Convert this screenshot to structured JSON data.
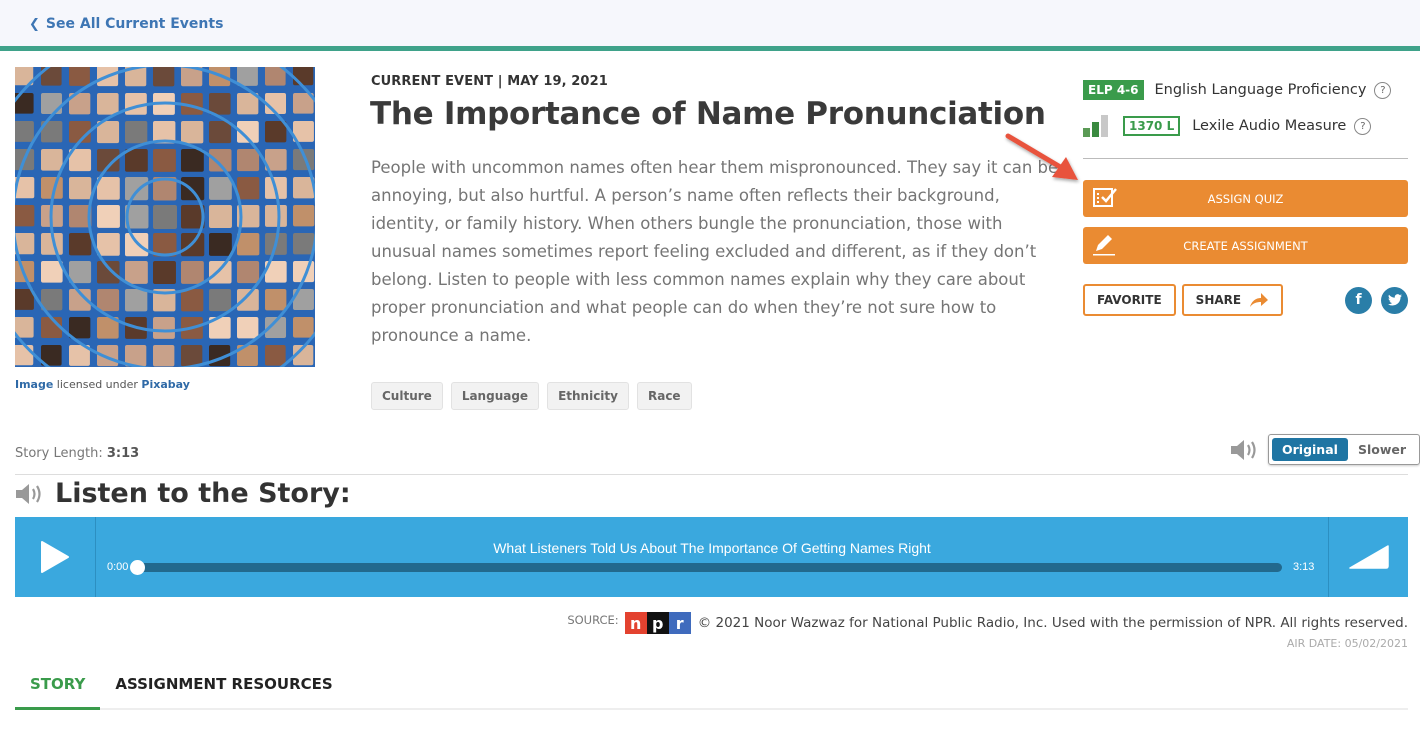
{
  "nav": {
    "back_label": "See All Current Events",
    "back_icon": "chevron-left-icon"
  },
  "image": {
    "alt": "Collage of diverse faces on a globe grid",
    "credit_prefix": "Image",
    "credit_middle": " licensed under ",
    "credit_source": "Pixabay"
  },
  "article": {
    "eyebrow": "CURRENT EVENT | MAY 19, 2021",
    "title": "The Importance of Name Pronunciation",
    "summary": "People with uncommon names often hear them mispronounced. They say it can be annoying, but also hurtful. A person’s name often reflects their background, identity, or family history. When others bungle the pronunciation, those with unusual names sometimes report feeling excluded and different, as if they don’t belong. Listen to people with less common names explain why they care about proper pronunciation and what people can do when they’re not sure how to pronounce a name.",
    "tags": [
      "Culture",
      "Language",
      "Ethnicity",
      "Race"
    ]
  },
  "sidebar": {
    "elp_badge": "ELP 4-6",
    "elp_label": "English Language Proficiency",
    "lexile_badge": "1370 L",
    "lexile_label": "Lexile Audio Measure",
    "lexile_level_bars": {
      "filled": 2,
      "total": 3
    },
    "help_glyph": "?",
    "assign_quiz": "ASSIGN QUIZ",
    "create_assignment": "CREATE ASSIGNMENT",
    "favorite": "FAVORITE",
    "share": "SHARE",
    "facebook_glyph": "f",
    "twitter_glyph": "t"
  },
  "audio": {
    "story_length_label": "Story Length:",
    "story_length": "3:13",
    "speed_options": [
      "Original",
      "Slower"
    ],
    "speed_selected": "Original",
    "listen_heading": "Listen to the Story:",
    "track_title": "What Listeners Told Us About The Importance Of Getting Names Right",
    "current_time": "0:00",
    "duration": "3:13",
    "progress_fraction": 0.0
  },
  "source": {
    "label": "SOURCE:",
    "npr_letters": [
      "n",
      "p",
      "r"
    ],
    "npr_colors": [
      "#e3422f",
      "#111111",
      "#3f6bbd"
    ],
    "copyright": "© 2021 Noor Wazwaz for National Public Radio, Inc. Used with the permission of NPR. All rights reserved.",
    "air_date": "AIR DATE: 05/02/2021"
  },
  "tabs": [
    {
      "label": "STORY",
      "active": true
    },
    {
      "label": "ASSIGNMENT RESOURCES",
      "active": false
    }
  ],
  "colors": {
    "accent_green": "#3a9b4b",
    "accent_orange": "#ea8b32",
    "player_blue": "#3aa8de",
    "link_blue": "#3e76b4",
    "teal_bar": "#3fa28a"
  }
}
